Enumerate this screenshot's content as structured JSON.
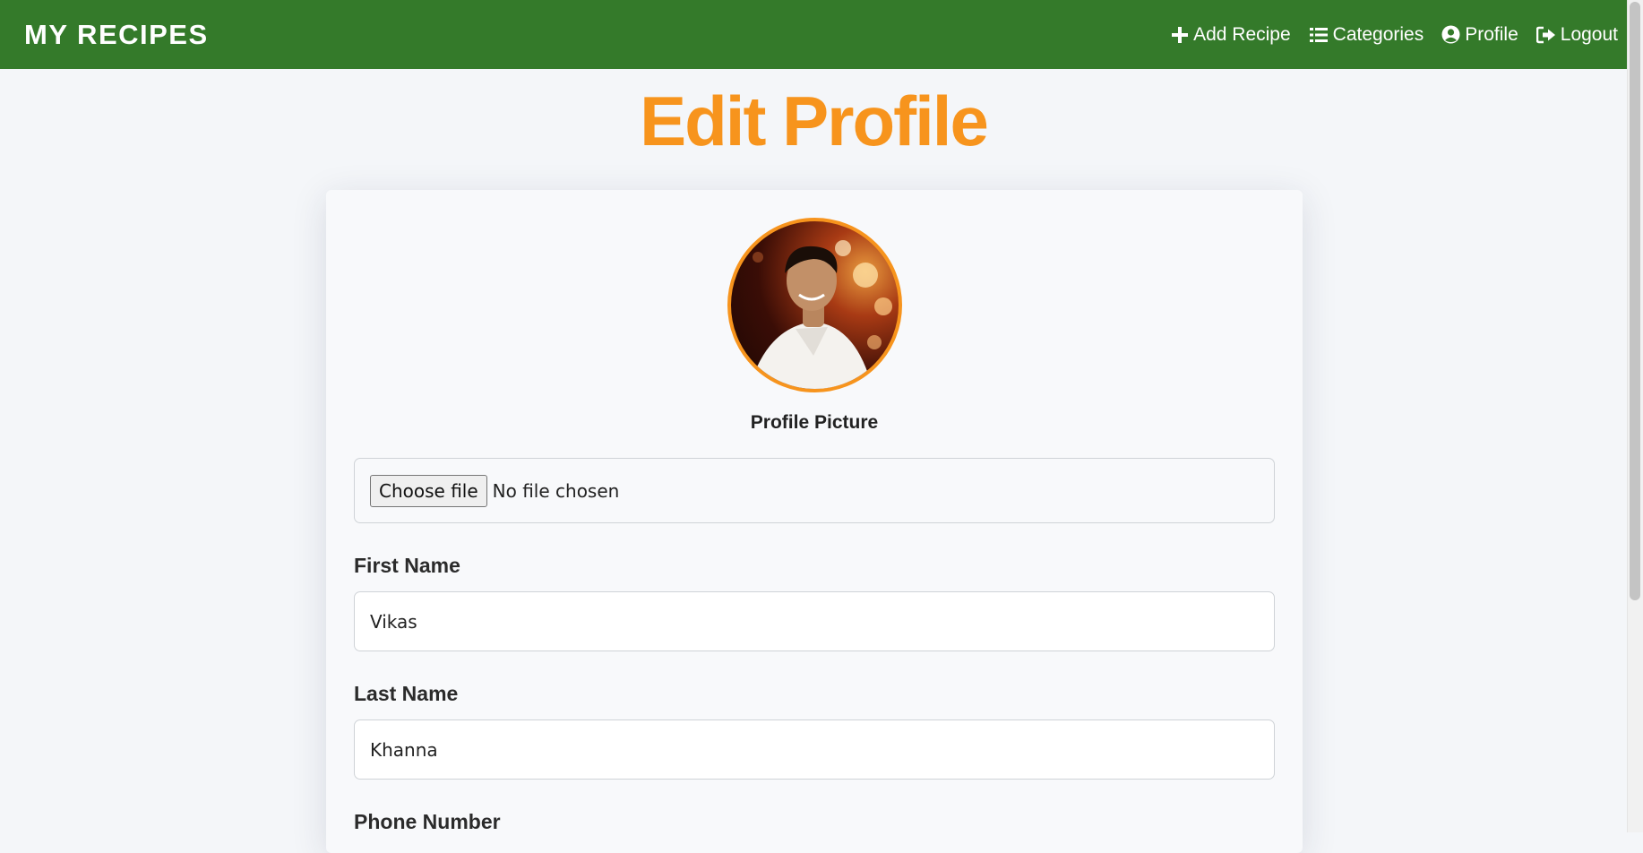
{
  "navbar": {
    "brand": "MY RECIPES",
    "links": [
      {
        "label": "Add Recipe",
        "icon": "plus-icon"
      },
      {
        "label": "Categories",
        "icon": "list-icon"
      },
      {
        "label": "Profile",
        "icon": "user-circle-icon"
      },
      {
        "label": "Logout",
        "icon": "sign-out-icon"
      }
    ]
  },
  "page": {
    "title": "Edit Profile"
  },
  "form": {
    "avatar_label": "Profile Picture",
    "file_button": "Choose file",
    "file_status": "No file chosen",
    "first_name_label": "First Name",
    "first_name_value": "Vikas",
    "last_name_label": "Last Name",
    "last_name_value": "Khanna",
    "phone_label": "Phone Number"
  },
  "colors": {
    "navbar": "#347a2a",
    "accent": "#f7941d",
    "background": "#f4f6f9"
  }
}
